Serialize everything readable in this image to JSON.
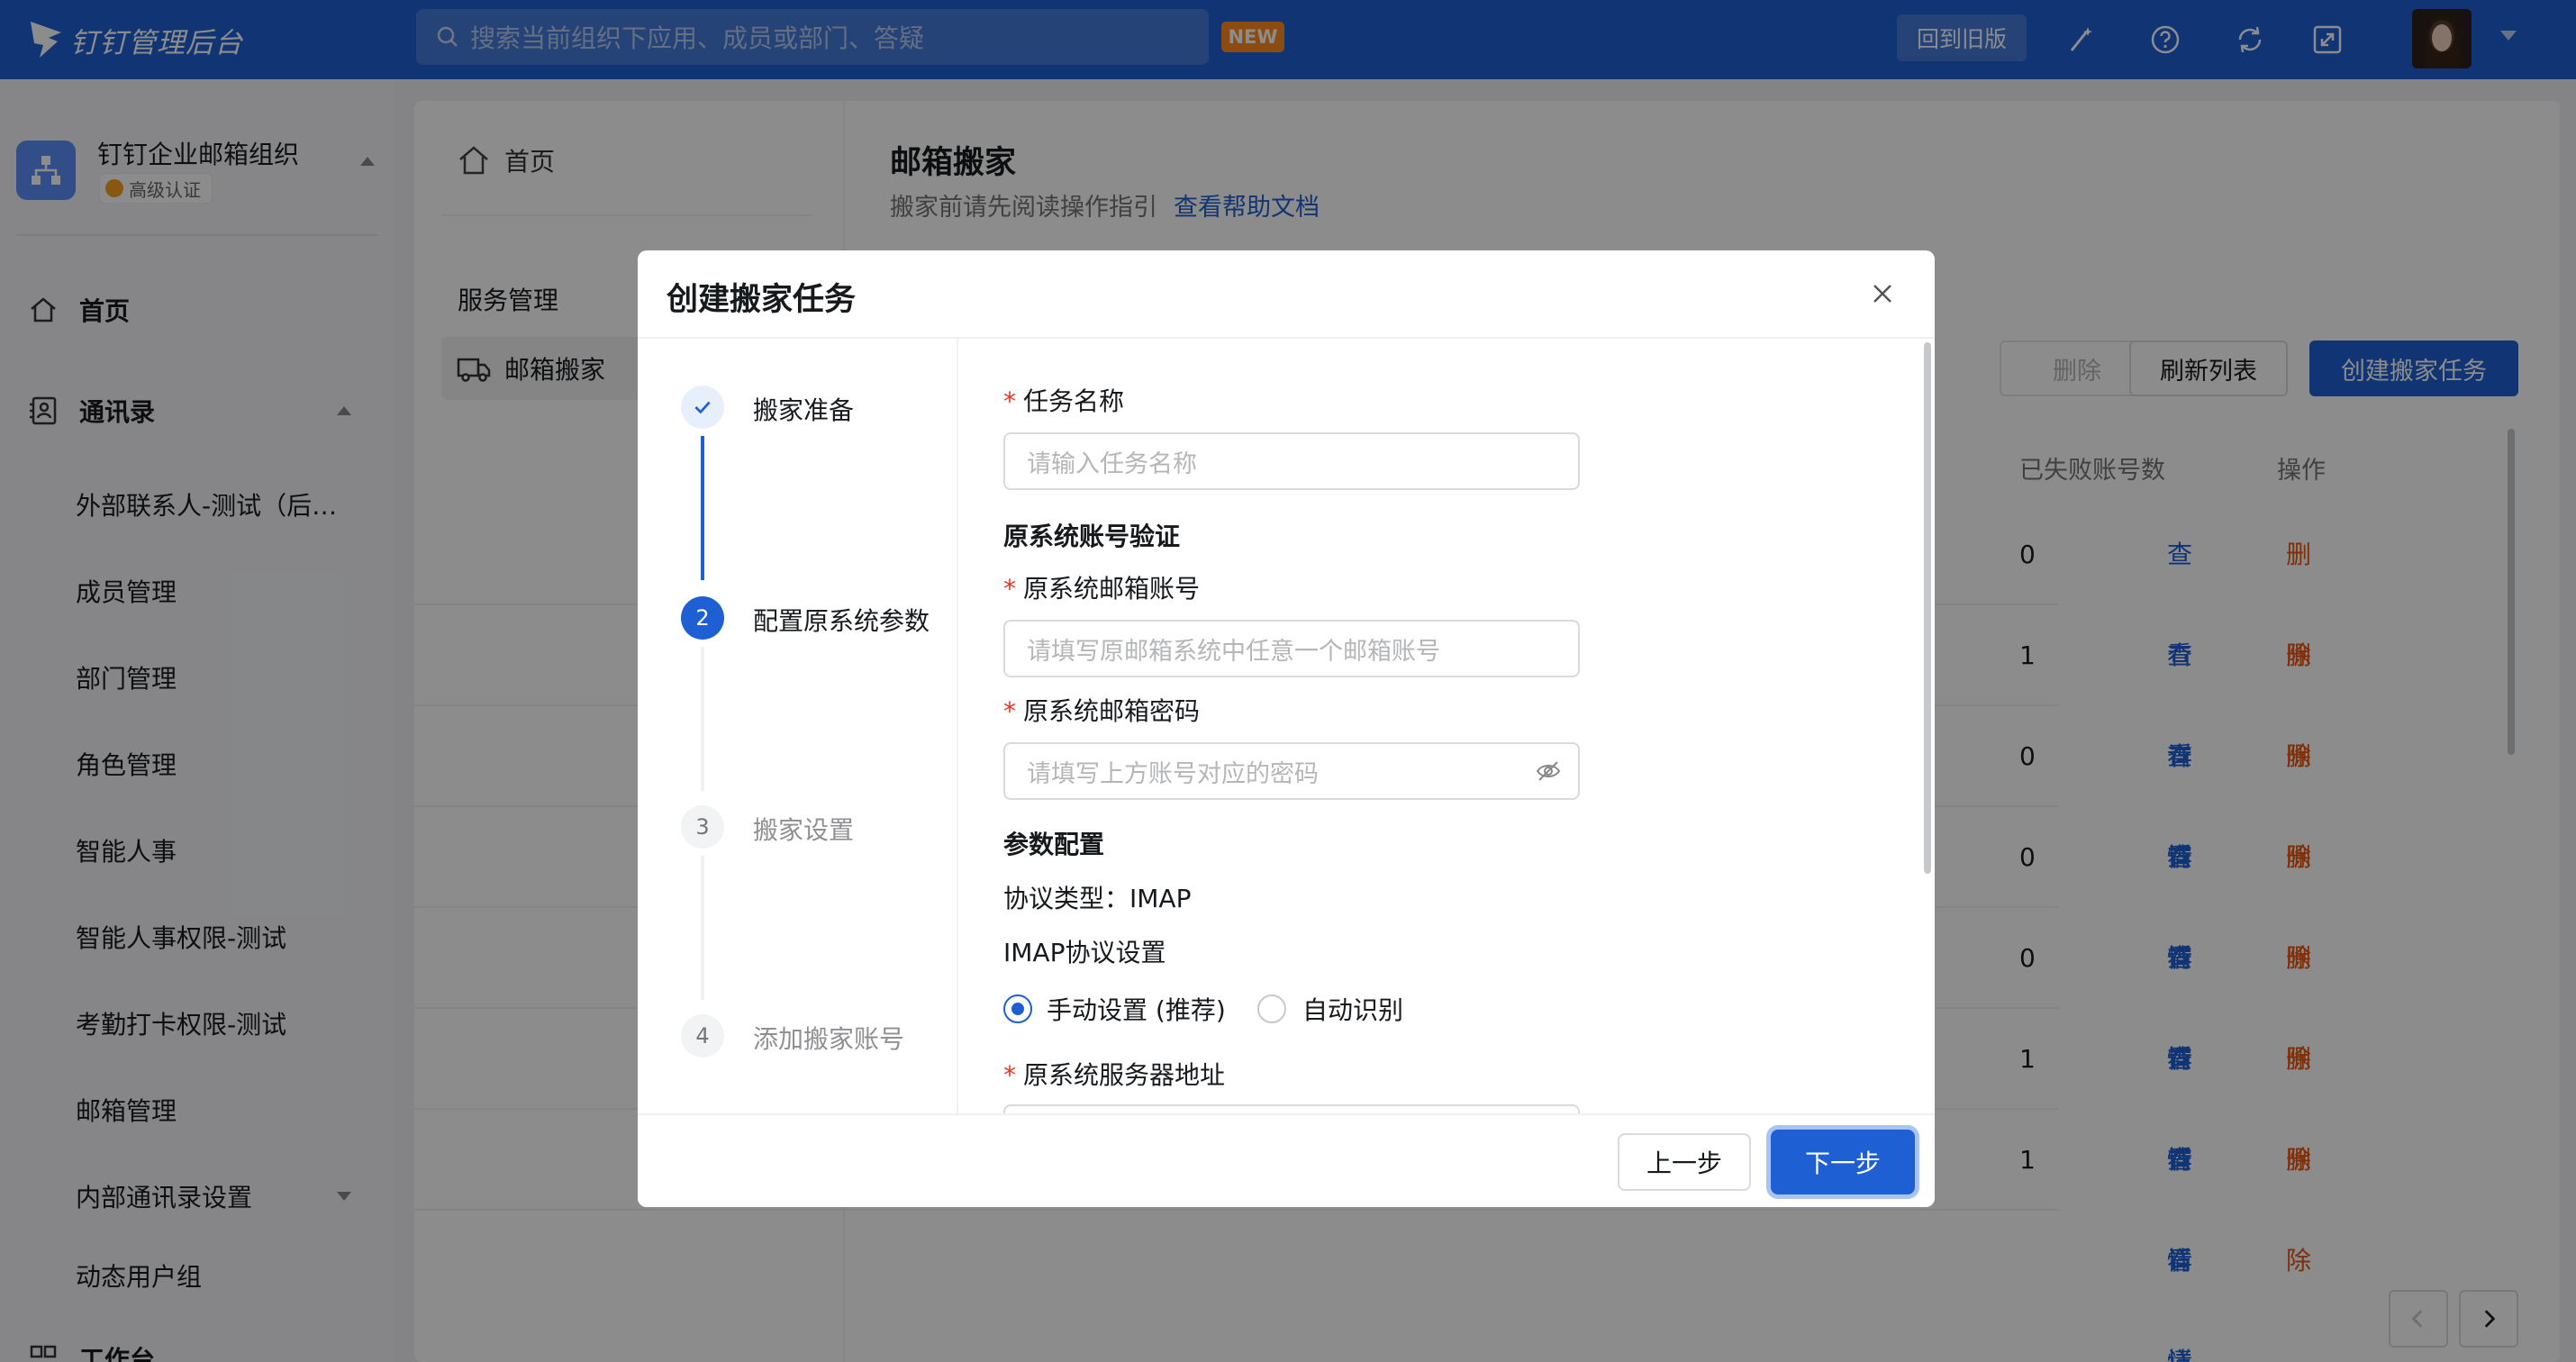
{
  "topbar": {
    "logo_text": "钉钉管理后台",
    "search_placeholder": "搜索当前组织下应用、成员或部门、答疑",
    "new_badge": "NEW",
    "old_version_label": "回到旧版",
    "icons": [
      "magic-wand-icon",
      "help-icon",
      "sync-icon",
      "fullscreen-icon"
    ]
  },
  "sidebar": {
    "org_name": "钉钉企业邮箱组织",
    "org_badge": "高级认证",
    "home_label": "首页",
    "contacts_label": "通讯录",
    "items": [
      "外部联系人-测试（后…",
      "成员管理",
      "部门管理",
      "角色管理",
      "智能人事",
      "智能人事权限-测试",
      "考勤打卡权限-测试",
      "邮箱管理",
      "内部通讯录设置",
      "动态用户组"
    ],
    "workbench_label": "工作台"
  },
  "subnav": {
    "home_label": "首页",
    "group_label": "服务管理",
    "active_label": "邮箱搬家"
  },
  "page": {
    "title": "邮箱搬家",
    "subtitle": "搬家前请先阅读操作指引",
    "help_link": "查看帮助文档",
    "toolbar": {
      "delete_label": "删除",
      "refresh_label": "刷新列表",
      "create_label": "创建搬家任务"
    },
    "columns": {
      "failed": "已失败账号数",
      "actions": "操作"
    },
    "rows": [
      {
        "failed": "0",
        "detail": "查看详情",
        "delete": "删除"
      },
      {
        "failed": "1",
        "detail": "查看详情",
        "delete": "删除"
      },
      {
        "failed": "0",
        "detail": "查看详情",
        "delete": "删除"
      },
      {
        "failed": "0",
        "detail": "查看详情",
        "delete": "删除"
      },
      {
        "failed": "0",
        "detail": "查看详情",
        "delete": "删除"
      },
      {
        "failed": "1",
        "detail": "查看详情",
        "delete": "删除"
      },
      {
        "failed": "1",
        "detail": "查看详情",
        "delete": "删除"
      }
    ]
  },
  "modal": {
    "title": "创建搬家任务",
    "steps": [
      {
        "label": "搬家准备",
        "state": "done",
        "number": "1"
      },
      {
        "label": "配置原系统参数",
        "state": "active",
        "number": "2"
      },
      {
        "label": "搬家设置",
        "state": "todo",
        "number": "3"
      },
      {
        "label": "添加搬家账号",
        "state": "todo",
        "number": "4"
      }
    ],
    "form": {
      "task_name_label": "任务名称",
      "task_name_placeholder": "请输入任务名称",
      "section_account": "原系统账号验证",
      "account_label": "原系统邮箱账号",
      "account_placeholder": "请填写原邮箱系统中任意一个邮箱账号",
      "password_label": "原系统邮箱密码",
      "password_placeholder": "请填写上方账号对应的密码",
      "section_params": "参数配置",
      "protocol_text": "协议类型：IMAP",
      "imap_settings": "IMAP协议设置",
      "radio_manual": "手动设置 (推荐)",
      "radio_auto": "自动识别",
      "radio_selected": "manual",
      "server_label": "原系统服务器地址",
      "required_mark": "*"
    },
    "prev_label": "上一步",
    "next_label": "下一步"
  },
  "colors": {
    "brand": "#1e5fd4",
    "danger": "#e8540f",
    "required": "#f0321e"
  }
}
